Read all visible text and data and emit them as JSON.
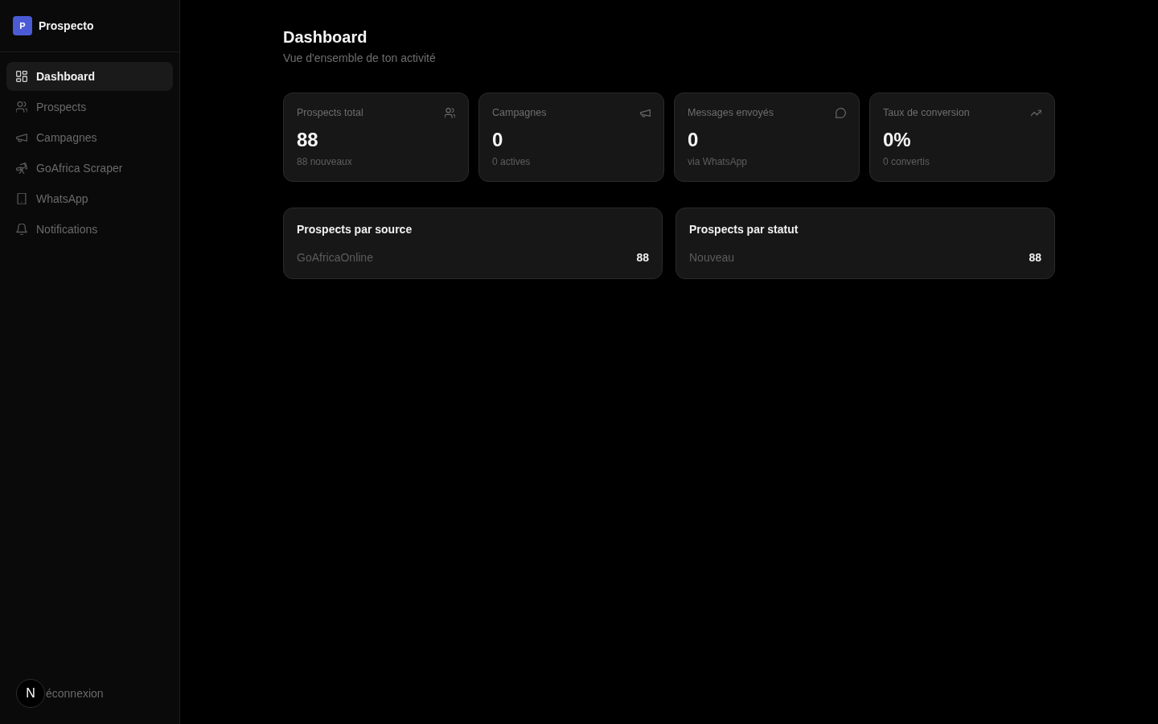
{
  "sidebar": {
    "logo": {
      "initial": "P",
      "name": "Prospecto"
    },
    "nav_items": [
      {
        "label": "Dashboard",
        "selected": true
      },
      {
        "label": "Prospects",
        "selected": false
      },
      {
        "label": "Campagnes",
        "selected": false
      },
      {
        "label": "GoAfrica Scraper",
        "selected": false
      },
      {
        "label": "WhatsApp",
        "selected": false
      },
      {
        "label": "Notifications",
        "selected": false
      }
    ],
    "dev_badge": {
      "label": "N"
    },
    "logout": {
      "label": "éconnexion"
    }
  },
  "header": {
    "title": "Dashboard",
    "subtitle": "Vue d'ensemble de ton activité"
  },
  "stat_cards": [
    {
      "label": "Prospects total",
      "value": "88",
      "note": "88 nouveaux"
    },
    {
      "label": "Campagnes",
      "value": "0",
      "note": "0 actives"
    },
    {
      "label": "Messages envoyés",
      "value": "0",
      "note": "via WhatsApp"
    },
    {
      "label": "Taux de conversion",
      "value": "0%",
      "note": "0 convertis"
    }
  ],
  "breakdowns": [
    {
      "title": "Prospects par source",
      "rows": [
        {
          "label": "GoAfricaOnline",
          "count": "88"
        }
      ]
    },
    {
      "title": "Prospects par statut",
      "rows": [
        {
          "label": "Nouveau",
          "count": "88"
        }
      ]
    }
  ]
}
